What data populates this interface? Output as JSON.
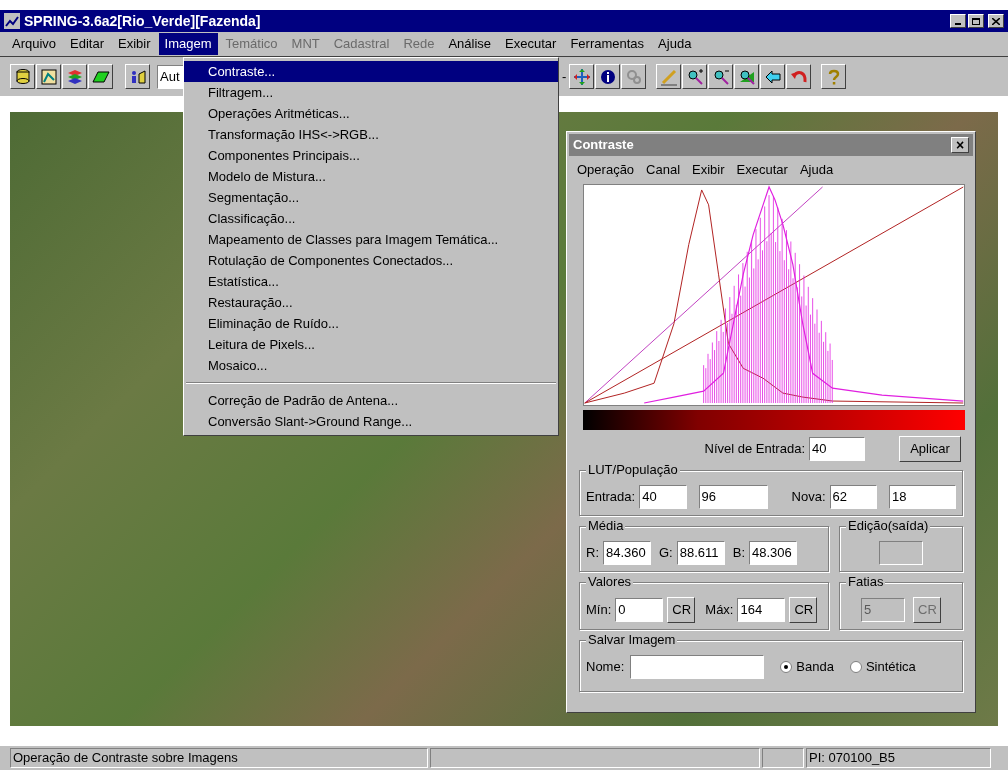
{
  "window": {
    "title": "SPRING-3.6a2[Rio_Verde][Fazenda]"
  },
  "menu_bar": [
    {
      "label": "Arquivo",
      "disabled": false,
      "selected": false
    },
    {
      "label": "Editar",
      "disabled": false,
      "selected": false
    },
    {
      "label": "Exibir",
      "disabled": false,
      "selected": false
    },
    {
      "label": "Imagem",
      "disabled": false,
      "selected": true
    },
    {
      "label": "Temático",
      "disabled": true,
      "selected": false
    },
    {
      "label": "MNT",
      "disabled": true,
      "selected": false
    },
    {
      "label": "Cadastral",
      "disabled": true,
      "selected": false
    },
    {
      "label": "Rede",
      "disabled": true,
      "selected": false
    },
    {
      "label": "Análise",
      "disabled": false,
      "selected": false
    },
    {
      "label": "Executar",
      "disabled": false,
      "selected": false
    },
    {
      "label": "Ferramentas",
      "disabled": false,
      "selected": false
    },
    {
      "label": "Ajuda",
      "disabled": false,
      "selected": false
    }
  ],
  "toolbar": {
    "combo_value": "Aut",
    "partial_text": "-"
  },
  "dropdown": {
    "groups": [
      [
        {
          "label": "Contraste...",
          "selected": true
        },
        {
          "label": "Filtragem...",
          "selected": false
        },
        {
          "label": "Operações Aritméticas...",
          "selected": false
        },
        {
          "label": "Transformação IHS<->RGB...",
          "selected": false
        },
        {
          "label": "Componentes Principais...",
          "selected": false
        },
        {
          "label": "Modelo de Mistura...",
          "selected": false
        },
        {
          "label": "Segmentação...",
          "selected": false
        },
        {
          "label": "Classificação...",
          "selected": false
        },
        {
          "label": "Mapeamento de Classes para Imagem Temática...",
          "selected": false
        },
        {
          "label": "Rotulação de Componentes Conectados...",
          "selected": false
        },
        {
          "label": "Estatística...",
          "selected": false
        },
        {
          "label": "Restauração...",
          "selected": false
        },
        {
          "label": "Eliminação de Ruído...",
          "selected": false
        },
        {
          "label": "Leitura de Pixels...",
          "selected": false
        },
        {
          "label": "Mosaico...",
          "selected": false
        }
      ],
      [
        {
          "label": "Correção de Padrão de Antena...",
          "selected": false
        },
        {
          "label": "Conversão Slant->Ground Range...",
          "selected": false
        }
      ]
    ]
  },
  "dialog": {
    "title": "Contraste",
    "close": "×",
    "menu": [
      "Operação",
      "Canal",
      "Exibir",
      "Executar",
      "Ajuda"
    ],
    "nivel": {
      "label": "Nível de Entrada:",
      "value": "40",
      "button": "Aplicar"
    },
    "lut": {
      "title": "LUT/População",
      "entrada_label": "Entrada:",
      "entrada": [
        "40",
        "96"
      ],
      "nova_label": "Nova:",
      "nova": [
        "62",
        "18"
      ]
    },
    "media": {
      "title": "Média",
      "fields": [
        {
          "label": "R:",
          "value": "84.360"
        },
        {
          "label": "G:",
          "value": "88.611"
        },
        {
          "label": "B:",
          "value": "48.306"
        }
      ]
    },
    "edicao": {
      "title": "Edição(saída)"
    },
    "valores": {
      "title": "Valores",
      "min_label": "Mín:",
      "min": "0",
      "min_button": "CR",
      "max_label": "Máx:",
      "max": "164",
      "max_button": "CR"
    },
    "fatias": {
      "title": "Fatias",
      "value": "5",
      "button": "CR",
      "disabled": true
    },
    "salvar": {
      "title": "Salvar Imagem",
      "name_label": "Nome:",
      "options": [
        {
          "label": "Banda",
          "selected": true
        },
        {
          "label": "Sintética",
          "selected": false
        }
      ]
    }
  },
  "status_bar": {
    "message": "Operação de Contraste sobre Imagens",
    "plane": "PI: 070100_B5"
  }
}
